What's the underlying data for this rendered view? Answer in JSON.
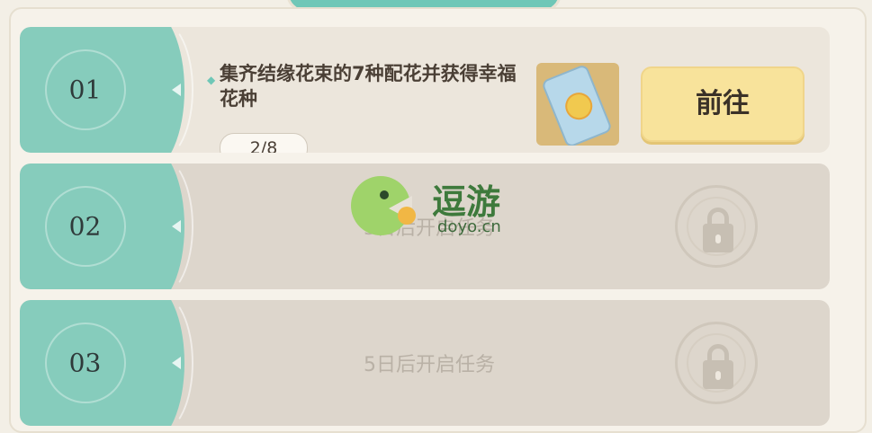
{
  "tasks": [
    {
      "number": "01",
      "status": "active",
      "title": "集齐结缘花束的7种配花并获得幸福花种",
      "progress": "2/8",
      "reward_icon": "flower-seed-bag-icon",
      "action_label": "前往"
    },
    {
      "number": "02",
      "status": "locked",
      "locked_text": "3日后开启任务"
    },
    {
      "number": "03",
      "status": "locked",
      "locked_text": "5日后开启任务"
    }
  ],
  "watermark": {
    "name": "逗游",
    "domain": "doyo.cn"
  },
  "colors": {
    "accent_teal": "#86ccbc",
    "button_yellow": "#f8e39b",
    "row_active": "#ece6dc",
    "row_locked": "#ddd6cc"
  }
}
